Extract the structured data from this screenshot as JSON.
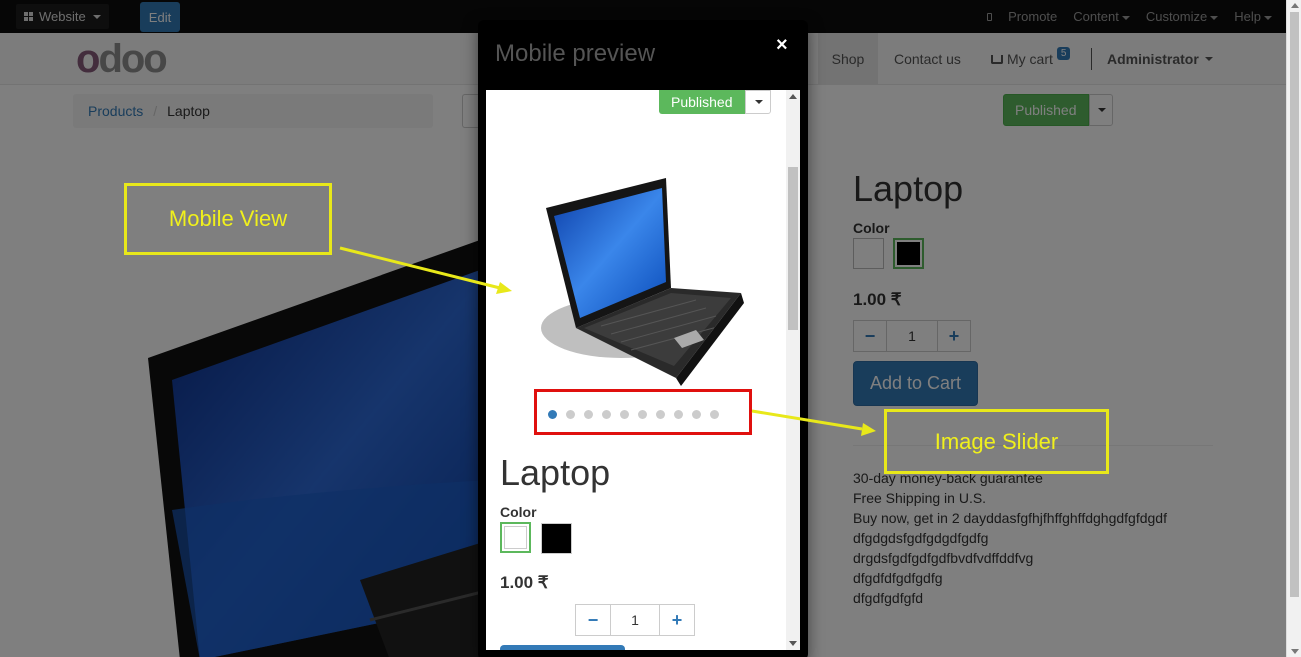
{
  "topbar": {
    "website_label": "Website",
    "edit_label": "Edit",
    "nav": [
      "Promote",
      "Content",
      "Customize",
      "Help"
    ]
  },
  "header": {
    "logo_o": "o",
    "logo_rest": "doo",
    "menu": {
      "shop": "Shop",
      "contact": "Contact us",
      "cart": "My cart",
      "cart_count": "5",
      "user": "Administrator"
    }
  },
  "breadcrumb": {
    "parent": "Products",
    "current": "Laptop"
  },
  "publish": {
    "label": "Published"
  },
  "product": {
    "title": "Laptop",
    "color_label": "Color",
    "price": "1.00 ₹",
    "quantity": "1",
    "minus": "−",
    "plus": "+",
    "add_to_cart": "Add to Cart",
    "description": [
      "30-day money-back guarantee",
      "Free Shipping in U.S.",
      "Buy now, get in 2 dayddasfgfhjfhffghffdghgdfgfdgdf",
      "dfgdgdsfgdfgdgdfgdfg",
      "drgdsfgdfgdfgdfbvdfvdffddfvg",
      "dfgdfdfgdfgdfg",
      "dfgdfgdfgfd"
    ]
  },
  "modal": {
    "title": "Mobile preview",
    "close": "×",
    "published": "Published",
    "slider_dot_count": 10,
    "active_dot": 0,
    "product_title": "Laptop",
    "color_label": "Color",
    "price": "1.00 ₹",
    "quantity": "1"
  },
  "annotations": {
    "mobile_view": "Mobile View",
    "image_slider": "Image Slider"
  },
  "colors": {
    "accent_blue": "#337ab7",
    "published_green": "#5cb85c",
    "annotation_yellow": "#e8e81a",
    "annotation_red": "#e0100e",
    "odoo_purple": "#875a7b"
  }
}
